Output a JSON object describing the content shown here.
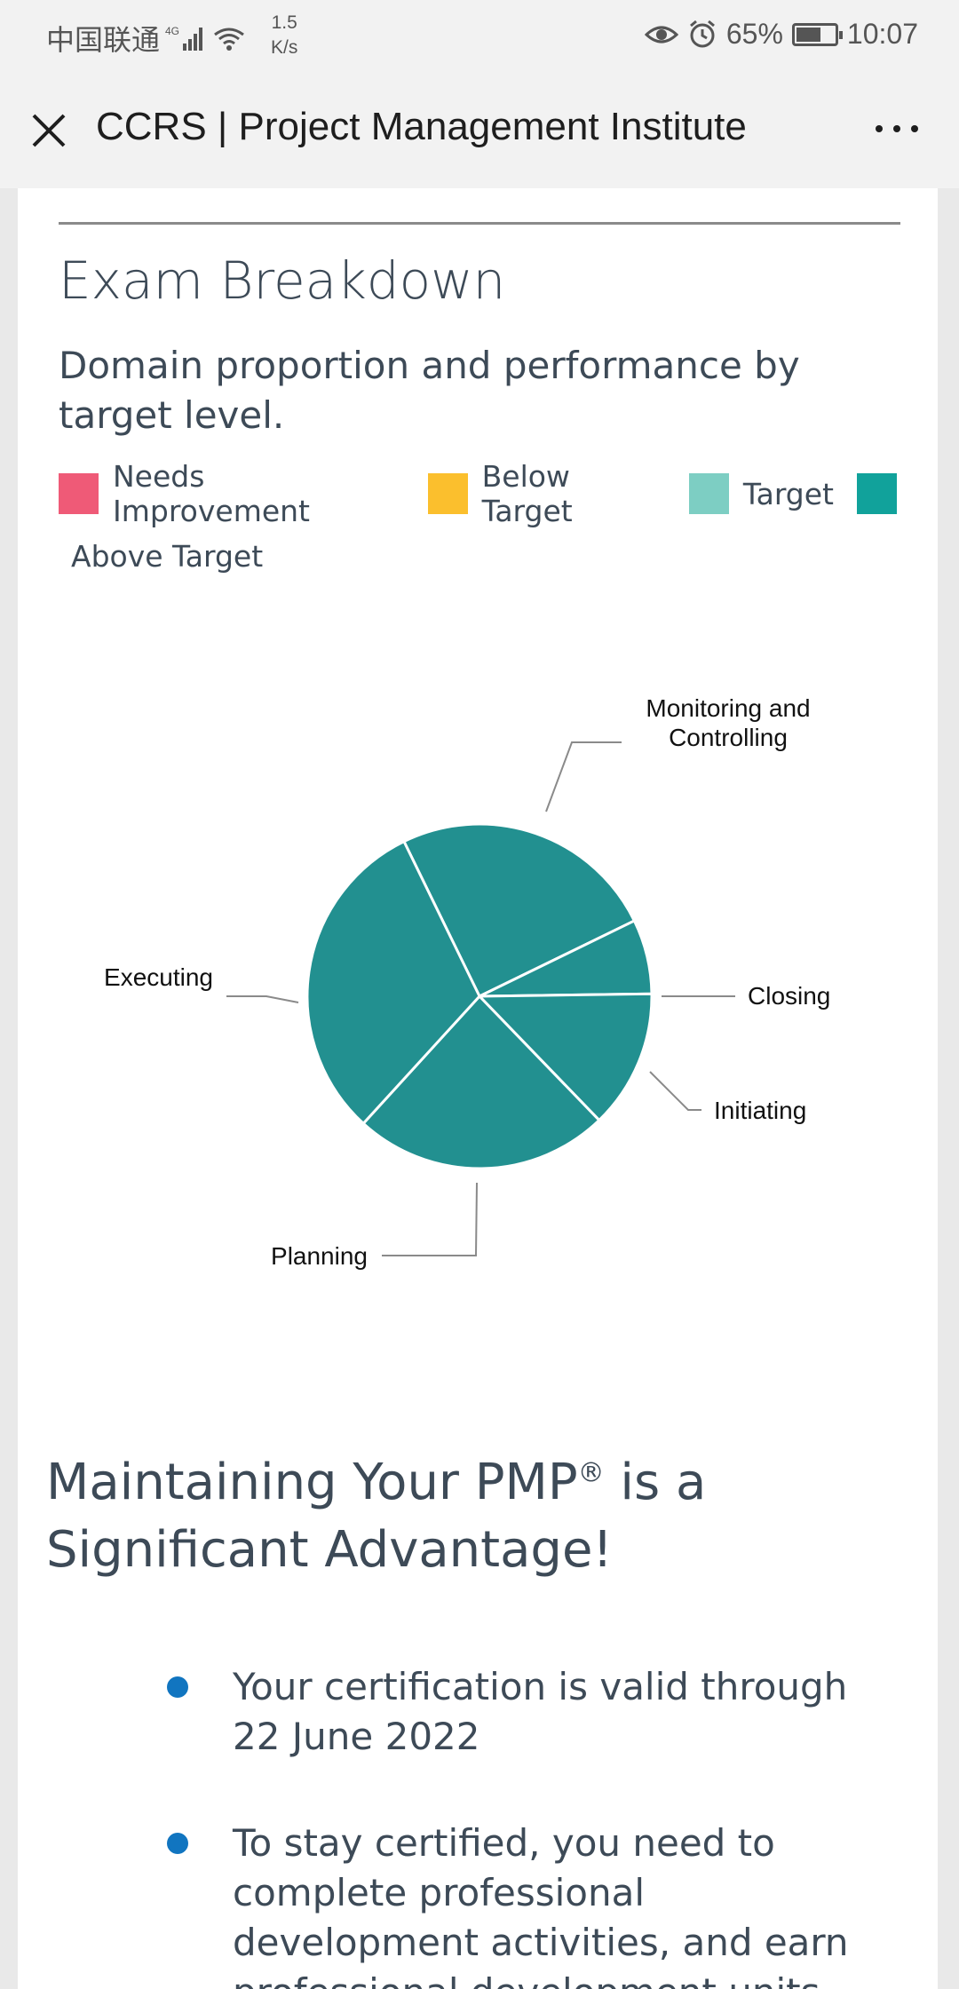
{
  "status_bar": {
    "carrier": "中国联通",
    "network": "4G",
    "speed_value": "1.5",
    "speed_unit": "K/s",
    "battery": "65%",
    "battery_level": 0.65,
    "time": "10:07"
  },
  "title_bar": {
    "title": "CCRS | Project Management Institute"
  },
  "exam_breakdown": {
    "heading": "Exam Breakdown",
    "subheading": "Domain proportion and performance by target level.",
    "legend": [
      {
        "label": "Needs Improvement",
        "color": "#ef5a77"
      },
      {
        "label": "Below Target",
        "color": "#fbbf2d"
      },
      {
        "label": "Target",
        "color": "#7dcec3"
      },
      {
        "label": "Above Target",
        "color": "#11a29b"
      }
    ]
  },
  "chart_data": {
    "type": "pie",
    "slice_color": "#229090",
    "slices": [
      {
        "label": "Monitoring and Controlling",
        "value": 25
      },
      {
        "label": "Closing",
        "value": 7
      },
      {
        "label": "Initiating",
        "value": 13
      },
      {
        "label": "Planning",
        "value": 24
      },
      {
        "label": "Executing",
        "value": 31
      }
    ]
  },
  "maintain": {
    "heading_part1": "Maintaining Your PMP",
    "heading_sup": "®",
    "heading_part2": " is a Significant Advantage!",
    "bullets": [
      "Your certification is valid through 22 June 2022",
      "To stay certified, you need to complete professional development activities, and earn professional development units"
    ]
  }
}
